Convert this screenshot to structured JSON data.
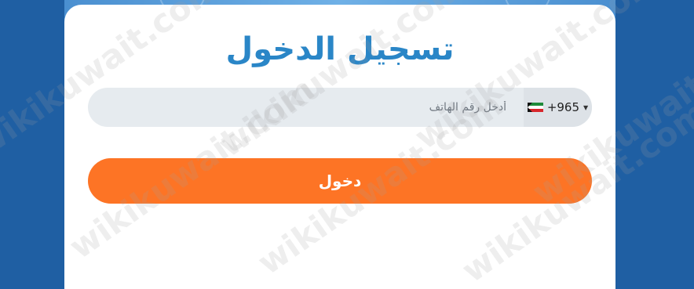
{
  "login": {
    "title": "تسجيل الدخول",
    "phone_placeholder": "أدخل رقم الهاتف",
    "phone_value": "",
    "country_code": "+965",
    "country_flag": "kuwait-flag-icon",
    "submit_label": "دخول"
  },
  "watermark": {
    "text": "wikikuwait.com"
  },
  "colors": {
    "title": "#2a86c7",
    "button": "#fd7425",
    "input_bg": "#e6ebef",
    "background": "#1f5fa3"
  }
}
